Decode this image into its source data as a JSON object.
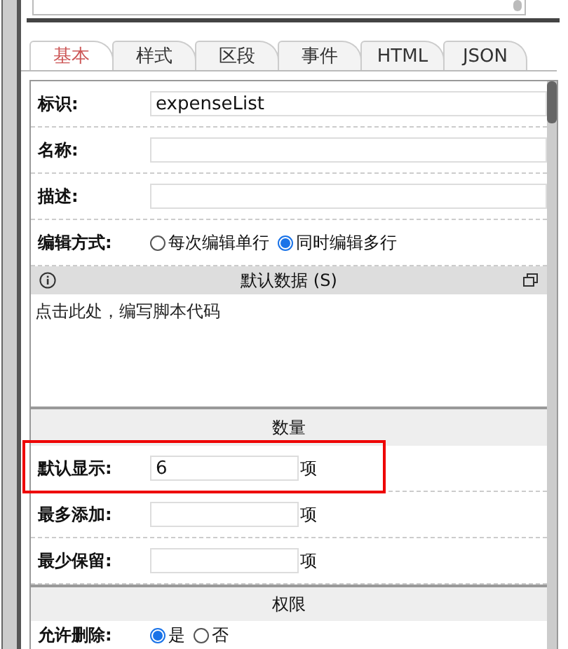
{
  "tabs": [
    {
      "label": "基本",
      "selected": true
    },
    {
      "label": "样式",
      "selected": false
    },
    {
      "label": "区段",
      "selected": false
    },
    {
      "label": "事件",
      "selected": false
    },
    {
      "label": "HTML",
      "selected": false
    },
    {
      "label": "JSON",
      "selected": false
    }
  ],
  "basic_fields": [
    {
      "kind": "text",
      "label": "标识:",
      "value": "expenseList"
    },
    {
      "kind": "text",
      "label": "名称:"
    },
    {
      "kind": "text",
      "label": "描述:"
    },
    {
      "kind": "radio",
      "label": "编辑方式:",
      "options": [
        {
          "label": "每次编辑单行",
          "selected": false
        },
        {
          "label": "同时编辑多行",
          "selected": true
        }
      ]
    }
  ],
  "default_data": {
    "title": "默认数据 (S)",
    "placeholder": "点击此处，编写脚本代码"
  },
  "quantity": {
    "title": "数量",
    "fields": [
      {
        "label": "默认显示:",
        "value": "6",
        "unit": "项",
        "highlighted": true
      },
      {
        "label": "最多添加:",
        "unit": "项",
        "highlighted": false
      },
      {
        "label": "最少保留:",
        "unit": "项",
        "highlighted": false
      }
    ]
  },
  "permissions": {
    "title": "权限",
    "fields": [
      {
        "label": "允许删除:",
        "options": [
          {
            "label": "是",
            "selected": true
          },
          {
            "label": "否",
            "selected": false
          }
        ]
      }
    ]
  }
}
